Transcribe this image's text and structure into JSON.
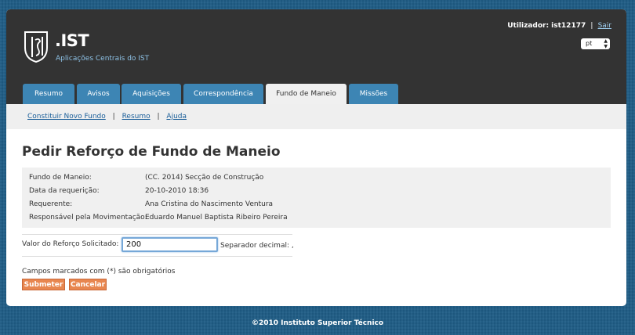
{
  "header": {
    "brand_title": ".IST",
    "brand_subtitle": "Aplicações Centrais do IST",
    "user_label": "Utilizador: ist12177",
    "separator": "|",
    "logout_label": "Sair",
    "language": "pt",
    "logo_icon": "ist-logo-icon"
  },
  "tabs": [
    {
      "label": "Resumo"
    },
    {
      "label": "Avisos"
    },
    {
      "label": "Aquisições"
    },
    {
      "label": "Correspondência"
    },
    {
      "label": "Fundo de Maneio",
      "active": true
    },
    {
      "label": "Missões"
    }
  ],
  "subnav": {
    "items": [
      "Constituir Novo Fundo",
      "Resumo",
      "Ajuda"
    ],
    "separator": "|"
  },
  "page_title": "Pedir Reforço de Fundo de Maneio",
  "info": [
    {
      "label": "Fundo de Maneio:",
      "value": "(CC. 2014) Secção de Construção"
    },
    {
      "label": "Data da requerição:",
      "value": "20-10-2010 18:36"
    },
    {
      "label": "Requerente:",
      "value": "Ana Cristina do Nascimento Ventura"
    },
    {
      "label": "Responsável pela Movimentação:",
      "value": "Eduardo Manuel Baptista Ribeiro Pereira"
    }
  ],
  "form": {
    "value_label": "Valor do Reforço Solicitado:",
    "value": "200",
    "separator_label": "Separador decimal: ,",
    "required_note": "Campos marcados com (*) são obrigatórios",
    "submit_label": "Submeter",
    "cancel_label": "Cancelar"
  },
  "footer": "©2010 Instituto Superior Técnico",
  "colors": {
    "header_bg": "#333333",
    "tab_bg": "#3d85b4",
    "button_bg": "#e8864f",
    "page_bg": "#1f5d86"
  }
}
